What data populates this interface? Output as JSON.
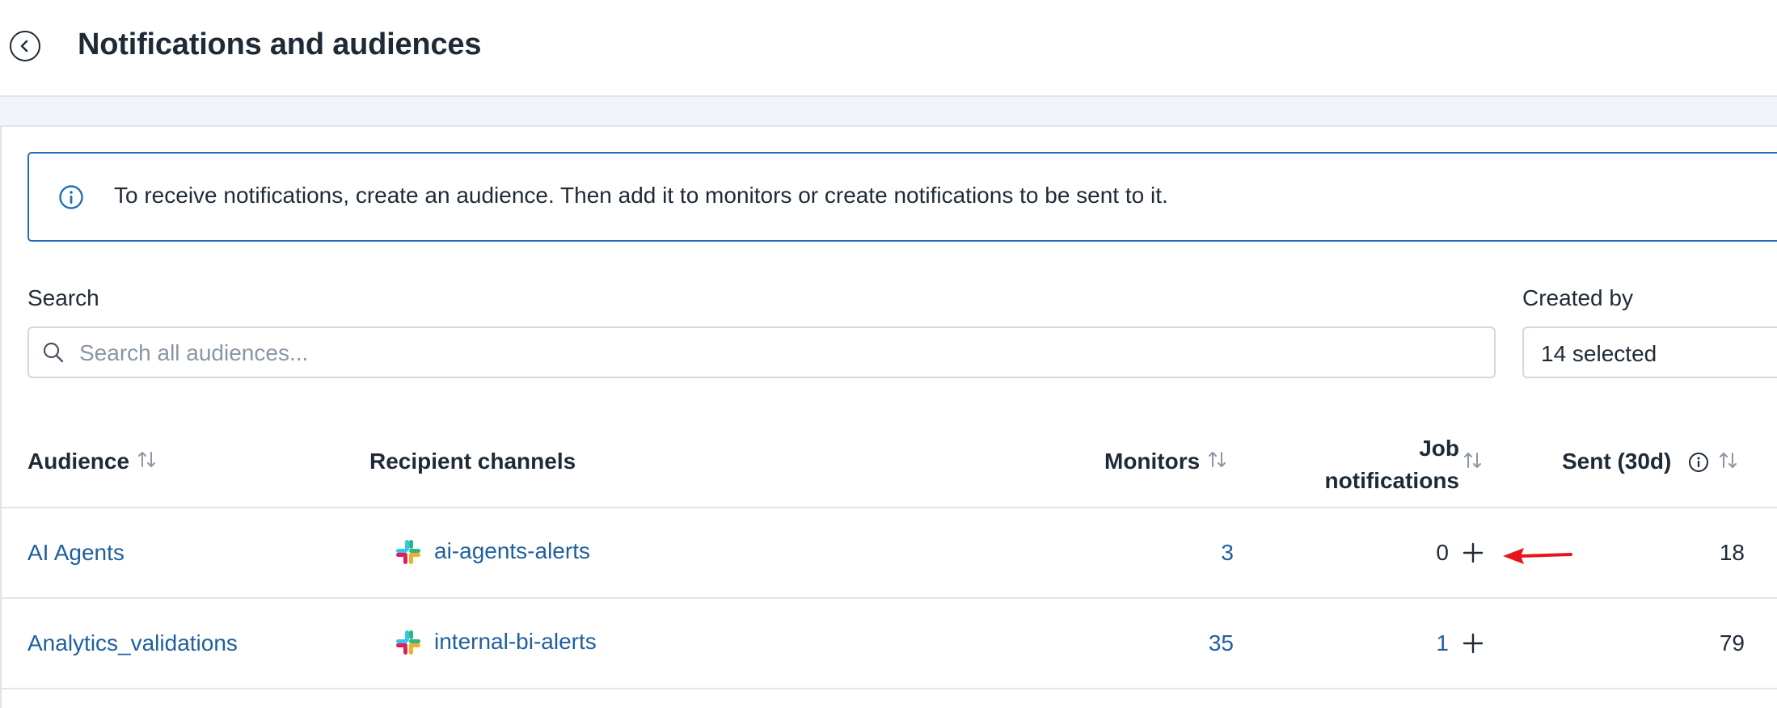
{
  "header": {
    "title": "Notifications and audiences"
  },
  "banner": {
    "text": "To receive notifications, create an audience. Then add it to monitors or create notifications to be sent to it."
  },
  "filters": {
    "search_label": "Search",
    "search_placeholder": "Search all audiences...",
    "search_value": "",
    "created_by_label": "Created by",
    "created_by_value": "14 selected"
  },
  "table": {
    "columns": {
      "audience": "Audience",
      "recipient_channels": "Recipient channels",
      "monitors": "Monitors",
      "job_notifications_line1": "Job",
      "job_notifications_line2": "notifications",
      "sent_30d": "Sent (30d)"
    },
    "rows": [
      {
        "audience": "AI Agents",
        "channel": "ai-agents-alerts",
        "monitors": "3",
        "job_notifications": "0",
        "sent_30d": "18"
      },
      {
        "audience": "Analytics_validations",
        "channel": "internal-bi-alerts",
        "monitors": "35",
        "job_notifications": "1",
        "sent_30d": "79"
      }
    ]
  },
  "icons": {
    "back": "chevron-left-circle-icon",
    "info": "info-circle-icon",
    "search": "search-icon",
    "sort": "sort-arrows-icon",
    "slack": "slack-icon",
    "plus": "plus-icon",
    "annotation": "red-arrow-annotation"
  },
  "colors": {
    "link": "#1f5f9e",
    "banner_border": "#1f6fb8",
    "annotation": "#e8141b",
    "slack_blue": "#36c5f0",
    "slack_green": "#2eb67d",
    "slack_yellow": "#ecb22e",
    "slack_red": "#e01e5a"
  }
}
